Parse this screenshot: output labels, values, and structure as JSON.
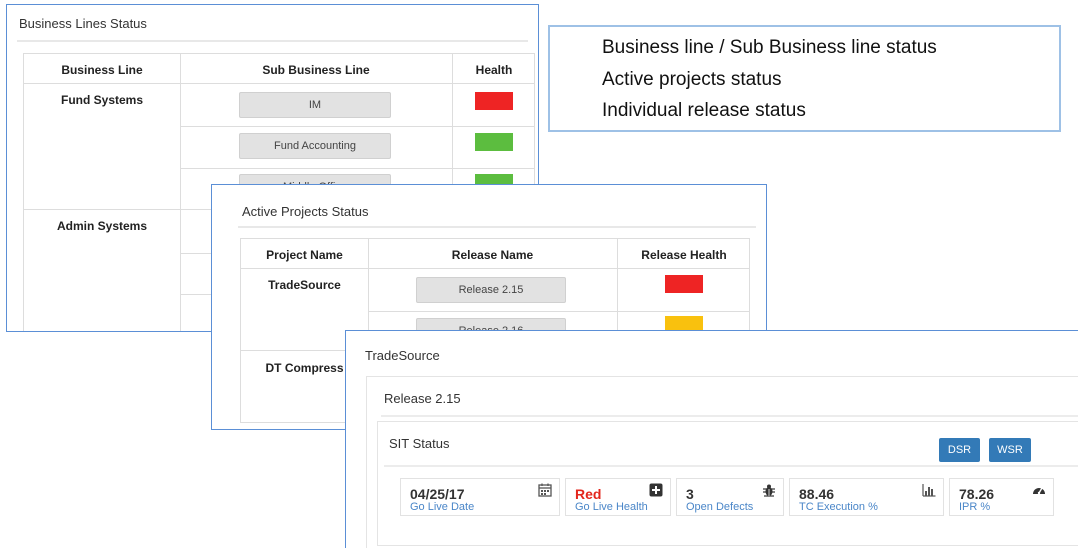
{
  "business_lines_panel": {
    "title": "Business Lines Status",
    "headers": [
      "Business Line",
      "Sub Business Line",
      "Health"
    ],
    "rows": [
      {
        "business_line": "Fund Systems",
        "sub_business_line": "IM",
        "health": "#ee2424"
      },
      {
        "business_line": "",
        "sub_business_line": "Fund Accounting",
        "health": "#5cbd3f"
      },
      {
        "business_line": "",
        "sub_business_line": "Middle Office",
        "health": "#5cbd3f"
      },
      {
        "business_line": "Admin Systems",
        "sub_business_line": "",
        "health": ""
      }
    ]
  },
  "active_projects_panel": {
    "title": "Active Projects Status",
    "headers": [
      "Project Name",
      "Release Name",
      "Release Health"
    ],
    "rows": [
      {
        "project": "TradeSource",
        "release": "Release 2.15",
        "health": "#ee2424"
      },
      {
        "project": "",
        "release": "Release 2.16",
        "health": "#f9c10e"
      },
      {
        "project": "DT Compress",
        "release": "",
        "health": ""
      }
    ]
  },
  "tradesource_panel": {
    "title": "TradeSource",
    "release_title": "Release 2.15",
    "sit_title": "SIT Status",
    "buttons": {
      "dsr": "DSR",
      "wsr": "WSR"
    },
    "metrics": [
      {
        "value": "04/25/17",
        "label": "Go Live Date",
        "icon": "calendar-icon"
      },
      {
        "value": "Red",
        "label": "Go Live Health",
        "icon": "plus-square-icon",
        "value_color": "#e3261c"
      },
      {
        "value": "3",
        "label": "Open Defects",
        "icon": "bug-icon"
      },
      {
        "value": "88.46",
        "label": "TC Execution %",
        "icon": "bar-chart-icon"
      },
      {
        "value": "78.26",
        "label": "IPR %",
        "icon": "dashboard-icon"
      }
    ]
  },
  "summary_box": {
    "lines": [
      "Business line / Sub Business line status",
      "Active projects status",
      "Individual release status"
    ]
  },
  "colors": {
    "accent": "#337ab7",
    "red": "#ee2424",
    "green": "#5cbd3f",
    "amber": "#f9c10e",
    "border": "#5b8fd6"
  }
}
